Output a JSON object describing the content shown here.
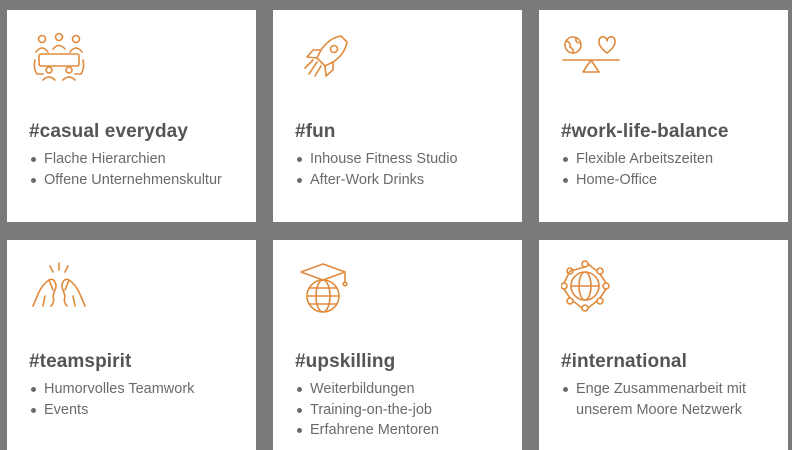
{
  "theme": {
    "accent": "#e08a3c",
    "background": "#7a7a7a",
    "card": "#ffffff",
    "title_color": "#555555",
    "text_color": "#6a6a6a"
  },
  "cards": [
    {
      "icon": "people-meeting-icon",
      "title": "#casual everyday",
      "items": [
        "Flache Hierarchien",
        "Offene Unternehmenskultur"
      ]
    },
    {
      "icon": "rocket-icon",
      "title": "#fun",
      "items": [
        "Inhouse Fitness Studio",
        "After-Work Drinks"
      ]
    },
    {
      "icon": "balance-scale-icon",
      "title": "#work-life-balance",
      "items": [
        "Flexible Arbeitszeiten",
        "Home-Office"
      ]
    },
    {
      "icon": "high-five-icon",
      "title": "#teamspirit",
      "items": [
        "Humorvolles Teamwork",
        "Events"
      ]
    },
    {
      "icon": "graduation-globe-icon",
      "title": "#upskilling",
      "items": [
        "Weiterbildungen",
        "Training-on-the-job",
        "Erfahrene Mentoren"
      ]
    },
    {
      "icon": "network-icon",
      "title": "#international",
      "items": [
        "Enge Zusammenarbeit mit",
        "unserem Moore Netzwerk"
      ]
    }
  ]
}
